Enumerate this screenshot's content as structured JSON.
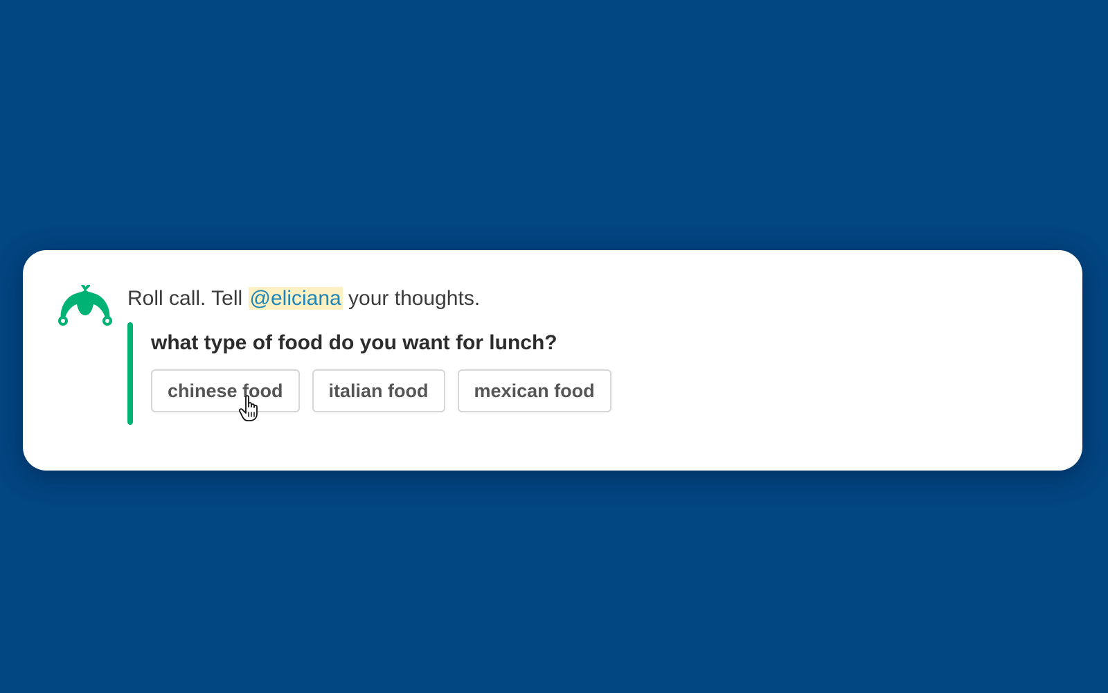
{
  "message": {
    "prefix": "Roll call. Tell ",
    "mention": "@eliciana",
    "suffix": " your thoughts."
  },
  "attachment": {
    "question": "what type of food do you want for lunch?",
    "buttons": [
      {
        "label": "chinese food"
      },
      {
        "label": "italian food"
      },
      {
        "label": "mexican food"
      }
    ]
  },
  "icons": {
    "app_logo": "surveymonkey-logo-icon",
    "cursor": "hand-pointer-cursor-icon"
  },
  "colors": {
    "background": "#024682",
    "card": "#ffffff",
    "accent_bar": "#00b273",
    "logo": "#00b273",
    "mention_bg": "#fdf1c4",
    "mention_text": "#1f84b8"
  }
}
